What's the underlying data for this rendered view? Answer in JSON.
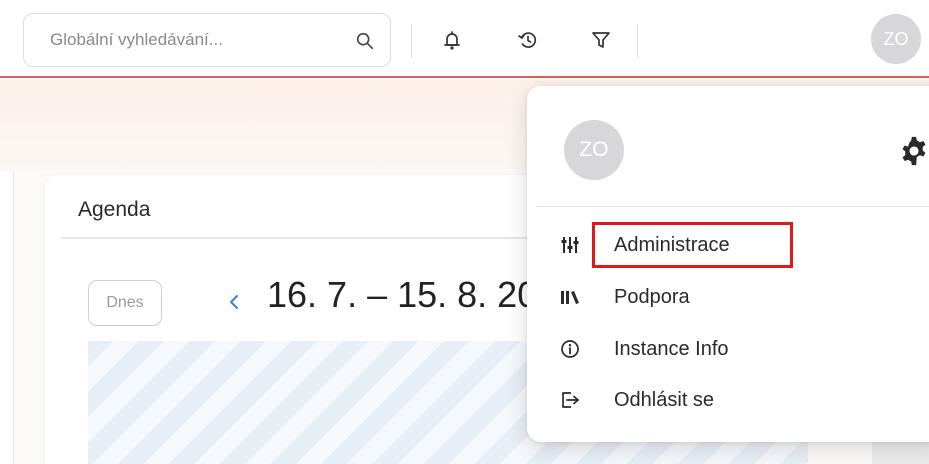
{
  "header": {
    "search": {
      "placeholder": "Globální vyhledávání...",
      "value": ""
    },
    "icons": [
      "bell-icon",
      "history-icon",
      "filter-icon"
    ],
    "avatar_initials": "ZO"
  },
  "agenda": {
    "title": "Agenda",
    "today_label": "Dnes",
    "date_range": "16. 7. – 15. 8. 202"
  },
  "user_menu": {
    "avatar_initials": "ZO",
    "items": [
      {
        "label": "Administrace",
        "icon": "sliders-icon"
      },
      {
        "label": "Podpora",
        "icon": "library-icon"
      },
      {
        "label": "Instance Info",
        "icon": "info-icon"
      },
      {
        "label": "Odhlásit se",
        "icon": "logout-icon"
      }
    ]
  },
  "colors": {
    "accent_line": "#e25d5d",
    "highlight": "#e01a1a",
    "avatar_bg": "#d7d7d9",
    "chevron": "#3b82d6"
  }
}
